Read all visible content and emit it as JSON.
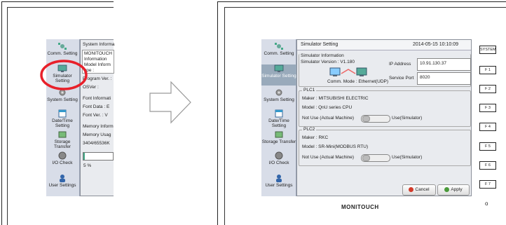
{
  "left": {
    "sidebar": [
      {
        "label": "Comm. Setting"
      },
      {
        "label": "Simulator Setting"
      },
      {
        "label": "System Setting"
      },
      {
        "label": "Date/Time Setting"
      },
      {
        "label": "Storage Transfer"
      },
      {
        "label": "I/O Check"
      },
      {
        "label": "User Settings"
      }
    ],
    "panel_title": "System Informa",
    "rows": [
      "MONITOUCH",
      "Information",
      "Model Inform",
      "ype :",
      "Program Ver. :",
      "OSVer :"
    ],
    "font_group": "Font Informati",
    "font_rows": [
      "Font Data : E",
      "Font Ver. : V"
    ],
    "mem_group": "Memory Inform",
    "mem_rows": [
      "Memory Usag",
      "3404/65536K"
    ],
    "mem_percent": "5 %",
    "mem_fraction": 0.05
  },
  "right": {
    "title": "Simulator Setting",
    "datetime": "2014-05-15  10:10:09",
    "sidebar": [
      {
        "label": "Comm. Setting"
      },
      {
        "label": "Simulator Setting"
      },
      {
        "label": "System Setting"
      },
      {
        "label": "Date/Time Setting"
      },
      {
        "label": "Storage Transfer"
      },
      {
        "label": "I/O Check"
      },
      {
        "label": "User Settings"
      }
    ],
    "sim_group": "Simulator Information",
    "sim_version": "Simulator Version :  V1.180",
    "ip_label": "IP Address",
    "ip_value": "10.91.130.37",
    "port_label": "Service Port",
    "port_value": "8020",
    "comm_mode": "Comm. Mode :  Ethernet(UDP)",
    "plc1": {
      "group": "PLC1",
      "maker": "Maker :  MITSUBISHI ELECTRIC",
      "model": "Model :  QnU series CPU",
      "not_use": "Not Use (Actual Machine)",
      "use": "Use(Simulator)"
    },
    "plc2": {
      "group": "PLC2",
      "maker": "Maker :  RKC",
      "model": "Model :  SR-Mini(MODBUS RTU)",
      "not_use": "Not Use (Actual Machine)",
      "use": "Use(Simulator)"
    },
    "cancel": "Cancel",
    "apply": "Apply",
    "brand": "MONITOUCH",
    "fkeys": [
      "SYSTEM",
      "F 1",
      "F 2",
      "F 3",
      "F 4",
      "F 5",
      "F 6",
      "F 7"
    ],
    "power_symbol": "o"
  },
  "colors": {
    "highlight": "#e8202a",
    "arrow": "#c8c8c8",
    "cancel_icon": "#d23a2a",
    "apply_icon": "#4a9a3a"
  }
}
